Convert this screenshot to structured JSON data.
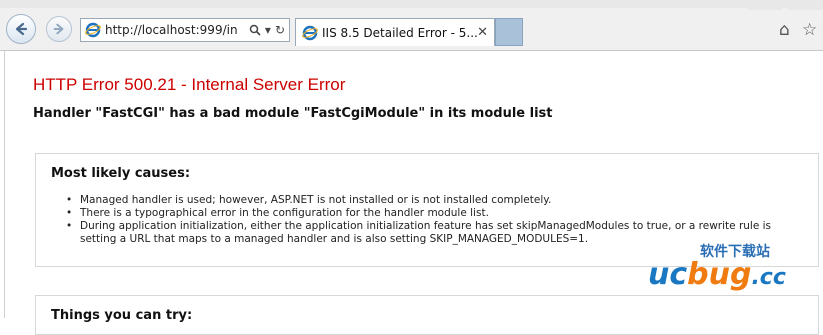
{
  "browser": {
    "address_url": "http://localhost:999/in",
    "tab_title": "IIS 8.5 Detailed Error - 5...",
    "icons": {
      "back": "back-arrow-icon",
      "forward": "forward-arrow-icon",
      "site": "ie-logo-icon",
      "search": "search-icon",
      "refresh": "refresh-icon",
      "close": "close-icon",
      "home": "home-icon",
      "favorites": "star-icon"
    }
  },
  "error": {
    "title": "HTTP Error 500.21 - Internal Server Error",
    "subtitle": "Handler \"FastCGI\" has a bad module \"FastCgiModule\" in its module list"
  },
  "causes": {
    "heading": "Most likely causes:",
    "items": [
      "Managed handler is used; however, ASP.NET is not installed or is not installed completely.",
      "There is a typographical error in the configuration for the handler module list.",
      "During application initialization, either the application initialization feature has set skipManagedModules to true, or a rewrite rule is setting a URL that maps to a managed handler and is also setting SKIP_MANAGED_MODULES=1."
    ]
  },
  "try": {
    "heading": "Things you can try:"
  },
  "watermark": {
    "top_text": "软件下载站",
    "brand_a": "uc",
    "brand_b": "bug",
    "brand_c": ".cc"
  },
  "colors": {
    "error_red": "#cc0000",
    "ie_blue": "#1e73be",
    "watermark_blue": "#1a78c2",
    "watermark_orange": "#f07b10"
  }
}
